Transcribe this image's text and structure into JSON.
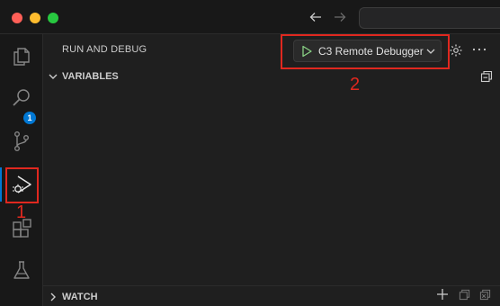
{
  "activity_bar": {
    "items": [
      {
        "icon": "files-icon"
      },
      {
        "icon": "search-icon"
      },
      {
        "icon": "source-control-icon",
        "badge": "1"
      },
      {
        "icon": "run-debug-icon",
        "active": true
      },
      {
        "icon": "extensions-icon"
      },
      {
        "icon": "testing-icon"
      }
    ]
  },
  "run_debug": {
    "title": "RUN AND DEBUG",
    "config_label": "C3 Remote Debugger"
  },
  "sections": {
    "variables": "VARIABLES",
    "watch": "WATCH"
  },
  "annotations": {
    "label_1": "1",
    "label_2": "2",
    "color": "#e0281f"
  },
  "colors": {
    "accent": "#0078d4",
    "play_green": "#89d185"
  }
}
